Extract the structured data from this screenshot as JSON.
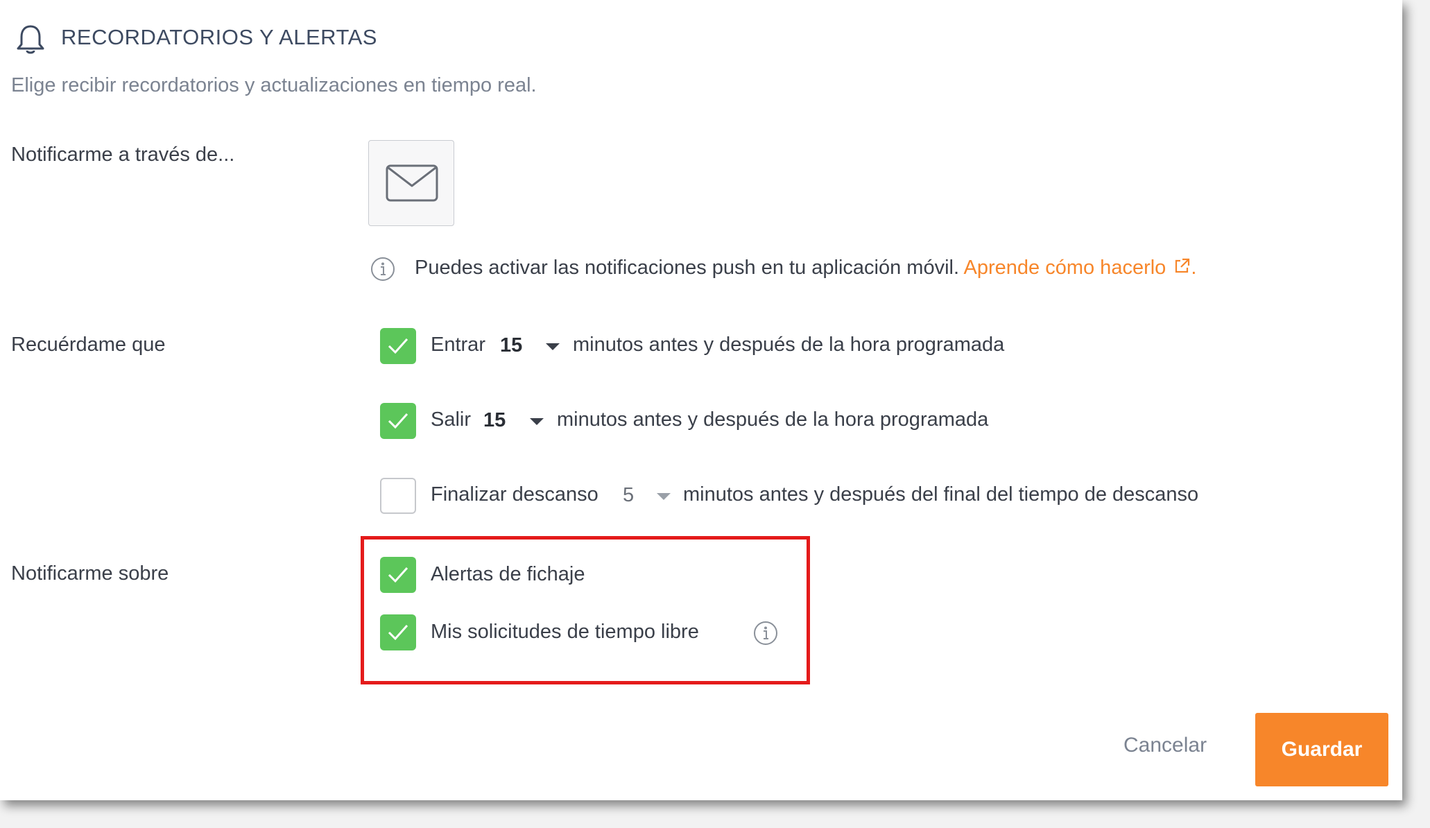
{
  "header": {
    "title": "RECORDATORIOS Y ALERTAS",
    "icon": "bell-icon",
    "subtitle": "Elige recibir recordatorios y actualizaciones en tiempo real."
  },
  "notify_via": {
    "label": "Notificarme a través de...",
    "channel_icon": "envelope-icon",
    "info_text": "Puedes activar las notificaciones push en tu aplicación móvil.",
    "link_text": "Aprende cómo hacerlo",
    "link_suffix": ".",
    "link_color": "#f7862a"
  },
  "remind_me": {
    "label": "Recuérdame que",
    "rows": [
      {
        "checked": true,
        "action": "Entrar",
        "value": "15",
        "text": "minutos antes y después de la hora programada"
      },
      {
        "checked": true,
        "action": "Salir",
        "value": "15",
        "text": "minutos antes y después de la hora programada"
      },
      {
        "checked": false,
        "action": "Finalizar descanso",
        "value": "5",
        "text": "minutos antes y después del final del tiempo de descanso"
      }
    ]
  },
  "notify_about": {
    "label": "Notificarme sobre",
    "items": [
      {
        "checked": true,
        "label": "Alertas de fichaje"
      },
      {
        "checked": true,
        "label": "Mis solicitudes de tiempo libre"
      }
    ]
  },
  "footer": {
    "cancel_label": "Cancelar",
    "save_label": "Guardar"
  },
  "colors": {
    "accent": "#f7862a",
    "checkbox_checked": "#5cc65a",
    "highlight": "#e41b1b"
  }
}
